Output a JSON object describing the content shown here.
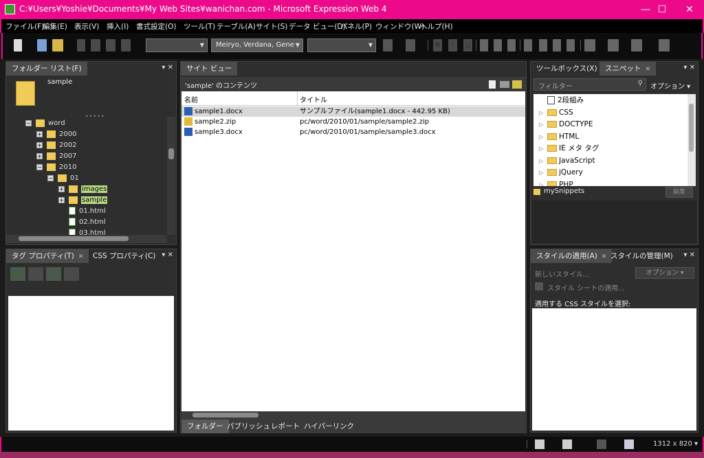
{
  "window": {
    "title": "C:¥Users¥Yoshie¥Documents¥My Web Sites¥wanichan.com - Microsoft Expression Web 4",
    "minimize": "—",
    "maximize": "☐",
    "close": "✕"
  },
  "menu": [
    "ファイル(F)",
    "編集(E)",
    "表示(V)",
    "挿入(I)",
    "書式設定(O)",
    "ツール(T)",
    "テーブル(A)",
    "サイト(S)",
    "データ ビュー(D)",
    "パネル(P)",
    "ウィンドウ(W)",
    "ヘルプ(H)"
  ],
  "toolbar": {
    "font": "Meiryo, Verdana, Gene",
    "bold": "B",
    "italic": "I",
    "underline": "U"
  },
  "folder_panel": {
    "tab": "フォルダー リスト(F)",
    "root": "sample",
    "tree": [
      {
        "label": "word",
        "level": 0,
        "expand": "−",
        "type": "folder"
      },
      {
        "label": "2000",
        "level": 1,
        "expand": "+",
        "type": "folder"
      },
      {
        "label": "2002",
        "level": 1,
        "expand": "+",
        "type": "folder"
      },
      {
        "label": "2007",
        "level": 1,
        "expand": "+",
        "type": "folder"
      },
      {
        "label": "2010",
        "level": 1,
        "expand": "−",
        "type": "folder"
      },
      {
        "label": "01",
        "level": 2,
        "expand": "−",
        "type": "folder"
      },
      {
        "label": "images",
        "level": 3,
        "expand": "+",
        "type": "folder-hl"
      },
      {
        "label": "sample",
        "level": 3,
        "expand": "+",
        "type": "folder-hl"
      },
      {
        "label": "01.html",
        "level": 3,
        "expand": "",
        "type": "page"
      },
      {
        "label": "02.html",
        "level": 3,
        "expand": "",
        "type": "page"
      },
      {
        "label": "03.html",
        "level": 3,
        "expand": "",
        "type": "page"
      }
    ]
  },
  "tag_panel": {
    "tab1": "タグ プロパティ(T)",
    "tab2": "CSS プロパティ(C)"
  },
  "site_view": {
    "tab": "サイト ビュー",
    "header": "'sample' のコンテンツ",
    "col_name": "名前",
    "col_title": "タイトル",
    "rows": [
      {
        "name": "sample1.docx",
        "title": "サンプルファイル(sample1.docx - 442.95 KB)",
        "icon": "word"
      },
      {
        "name": "sample2.zip",
        "title": "pc/word/2010/01/sample/sample2.zip",
        "icon": "zip"
      },
      {
        "name": "sample3.docx",
        "title": "pc/word/2010/01/sample/sample3.docx",
        "icon": "word"
      }
    ],
    "bottom_tabs": [
      "フォルダー",
      "パブリッシュ",
      "レポート",
      "ハイパーリンク"
    ]
  },
  "toolbox": {
    "tab1": "ツールボックス(X)",
    "tab2": "スニペット",
    "filter": "フィルター",
    "option": "オプション ▾",
    "items": [
      "2段組み",
      "CSS",
      "DOCTYPE",
      "HTML",
      "IE メタ タグ",
      "JavaScript",
      "jQuery",
      "PHP"
    ],
    "my": "mySnippets",
    "edit": "編集"
  },
  "styles": {
    "tab1": "スタイルの適用(A)",
    "tab2": "スタイルの管理(M)",
    "new": "新しいスタイル...",
    "option": "オプション ▾",
    "attach": "スタイル シートの適用...",
    "select": "適用する CSS スタイルを選択:"
  },
  "status": {
    "size": "1312 x 820 ▾"
  },
  "colors": {
    "accent": "#ec0a8a"
  }
}
